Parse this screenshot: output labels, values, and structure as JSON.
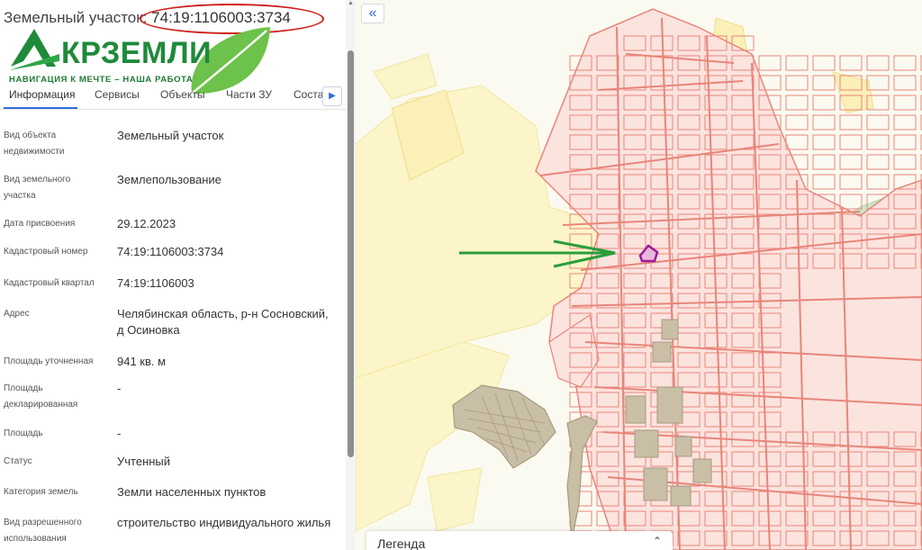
{
  "panel": {
    "title_prefix": "Земельный участок: ",
    "title_cadastral": "74:19:1106003:3734"
  },
  "logo": {
    "brand": "КРЗЕМЛИ",
    "slogan": "НАВИГАЦИЯ К МЕЧТЕ – НАША РАБОТА"
  },
  "tabs": [
    "Информация",
    "Сервисы",
    "Объекты",
    "Части ЗУ",
    "Соста"
  ],
  "properties": [
    {
      "label": "Вид объекта недвижимости",
      "value": "Земельный участок"
    },
    {
      "label": "Вид земельного участка",
      "value": "Землепользование"
    },
    {
      "label": "Дата присвоения",
      "value": "29.12.2023"
    },
    {
      "label": "Кадастровый номер",
      "value": "74:19:1106003:3734"
    },
    {
      "label": "Кадастровый квартал",
      "value": "74:19:1106003"
    },
    {
      "label": "Адрес",
      "value": "Челябинская область, р-н Сосновский, д Осиновка"
    },
    {
      "label": "Площадь уточненная",
      "value": "941 кв. м"
    },
    {
      "label": "Площадь декларированная",
      "value": "-"
    },
    {
      "label": "Площадь",
      "value": "-"
    },
    {
      "label": "Статус",
      "value": "Учтенный"
    },
    {
      "label": "Категория земель",
      "value": "Земли населенных пунктов"
    },
    {
      "label": "Вид разрешенного использования",
      "value": "строительство индивидуального жилья"
    }
  ],
  "map": {
    "collapse_icon": "double-chevron-left-icon",
    "legend_title": "Легенда",
    "legend_toggle_icon": "chevron-up-down-icon"
  },
  "colors": {
    "parcel_fill": "#fbe3de",
    "parcel_stroke": "#e8857a",
    "field": "#fbf5c9",
    "forest": "#c9e8c6",
    "selected": "#9b1b9b",
    "arrow": "#2a9d3a",
    "highlight_ring": "#d0201a",
    "brand": "#1f8a3a"
  }
}
